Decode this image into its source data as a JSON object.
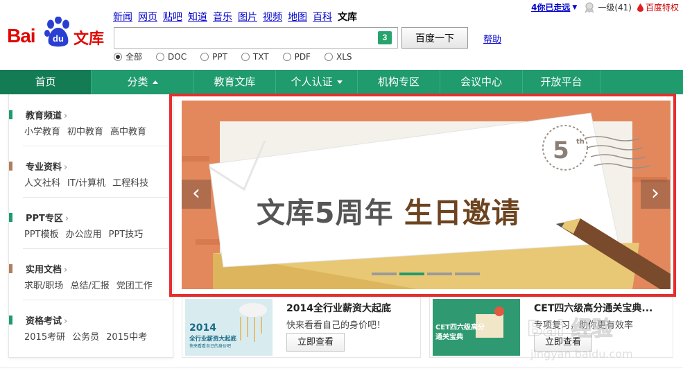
{
  "header": {
    "logo": {
      "bai": "Bai",
      "du": "du",
      "wenku": "文库"
    },
    "nav": [
      {
        "label": "新闻",
        "current": false
      },
      {
        "label": "网页",
        "current": false
      },
      {
        "label": "贴吧",
        "current": false
      },
      {
        "label": "知道",
        "current": false
      },
      {
        "label": "音乐",
        "current": false
      },
      {
        "label": "图片",
        "current": false
      },
      {
        "label": "视频",
        "current": false
      },
      {
        "label": "地图",
        "current": false
      },
      {
        "label": "百科",
        "current": false
      },
      {
        "label": "文库",
        "current": true
      }
    ],
    "search": {
      "value": "",
      "badge": "3",
      "button": "百度一下",
      "help": "帮助"
    },
    "filters": [
      {
        "label": "全部",
        "checked": true
      },
      {
        "label": "DOC",
        "checked": false
      },
      {
        "label": "PPT",
        "checked": false
      },
      {
        "label": "TXT",
        "checked": false
      },
      {
        "label": "PDF",
        "checked": false
      },
      {
        "label": "XLS",
        "checked": false
      }
    ],
    "user": {
      "name": "4你已走远",
      "level": "一级(41)",
      "privilege": "百度特权"
    }
  },
  "mainnav": [
    {
      "label": "首页",
      "icon": ""
    },
    {
      "label": "分类",
      "icon": "caret-up"
    },
    {
      "label": "教育文库",
      "icon": ""
    },
    {
      "label": "个人认证",
      "icon": "caret-down"
    },
    {
      "label": "机构专区",
      "icon": ""
    },
    {
      "label": "会议中心",
      "icon": ""
    },
    {
      "label": "开放平台",
      "icon": ""
    }
  ],
  "sidebar": [
    {
      "title": "教育频道",
      "color": "#1f9b6e",
      "links": [
        "小学教育",
        "初中教育",
        "高中教育"
      ]
    },
    {
      "title": "专业资料",
      "color": "#b07d5f",
      "links": [
        "人文社科",
        "IT/计算机",
        "工程科技"
      ]
    },
    {
      "title": "PPT专区",
      "color": "#1f9b6e",
      "links": [
        "PPT模板",
        "办公应用",
        "PPT技巧"
      ]
    },
    {
      "title": "实用文档",
      "color": "#b07d5f",
      "links": [
        "求职/职场",
        "总结/汇报",
        "党团工作"
      ]
    },
    {
      "title": "资格考试",
      "color": "#1f9b6e",
      "links": [
        "2015考研",
        "公务员",
        "2015中考"
      ]
    }
  ],
  "banner": {
    "main_text": "文库5周年",
    "highlight_text": "生日邀请",
    "stamp": "5",
    "stamp_suffix": "th",
    "active_dot": 1,
    "dot_count": 4,
    "prev": "‹",
    "next": "›"
  },
  "promos": [
    {
      "title": "2014全行业薪资大起底",
      "desc": "快来看看自己的身价吧！",
      "button": "立即查看",
      "img_lines": [
        "2014",
        "全行业薪资大起底",
        "快来看看自己的身价吧"
      ]
    },
    {
      "title": "CET四六级高分通关宝典...",
      "desc": "专项复习，助你更有效率",
      "button": "立即查看",
      "img_lines": [
        "CET四六级高分",
        "通关宝典"
      ]
    }
  ],
  "watermark": {
    "text": "Bai 经验",
    "url": "jingyan.baidu.com"
  },
  "colors": {
    "green": "#1f9b6e",
    "red_frame": "#e52e2e",
    "banner_bg": "#e2885c"
  }
}
